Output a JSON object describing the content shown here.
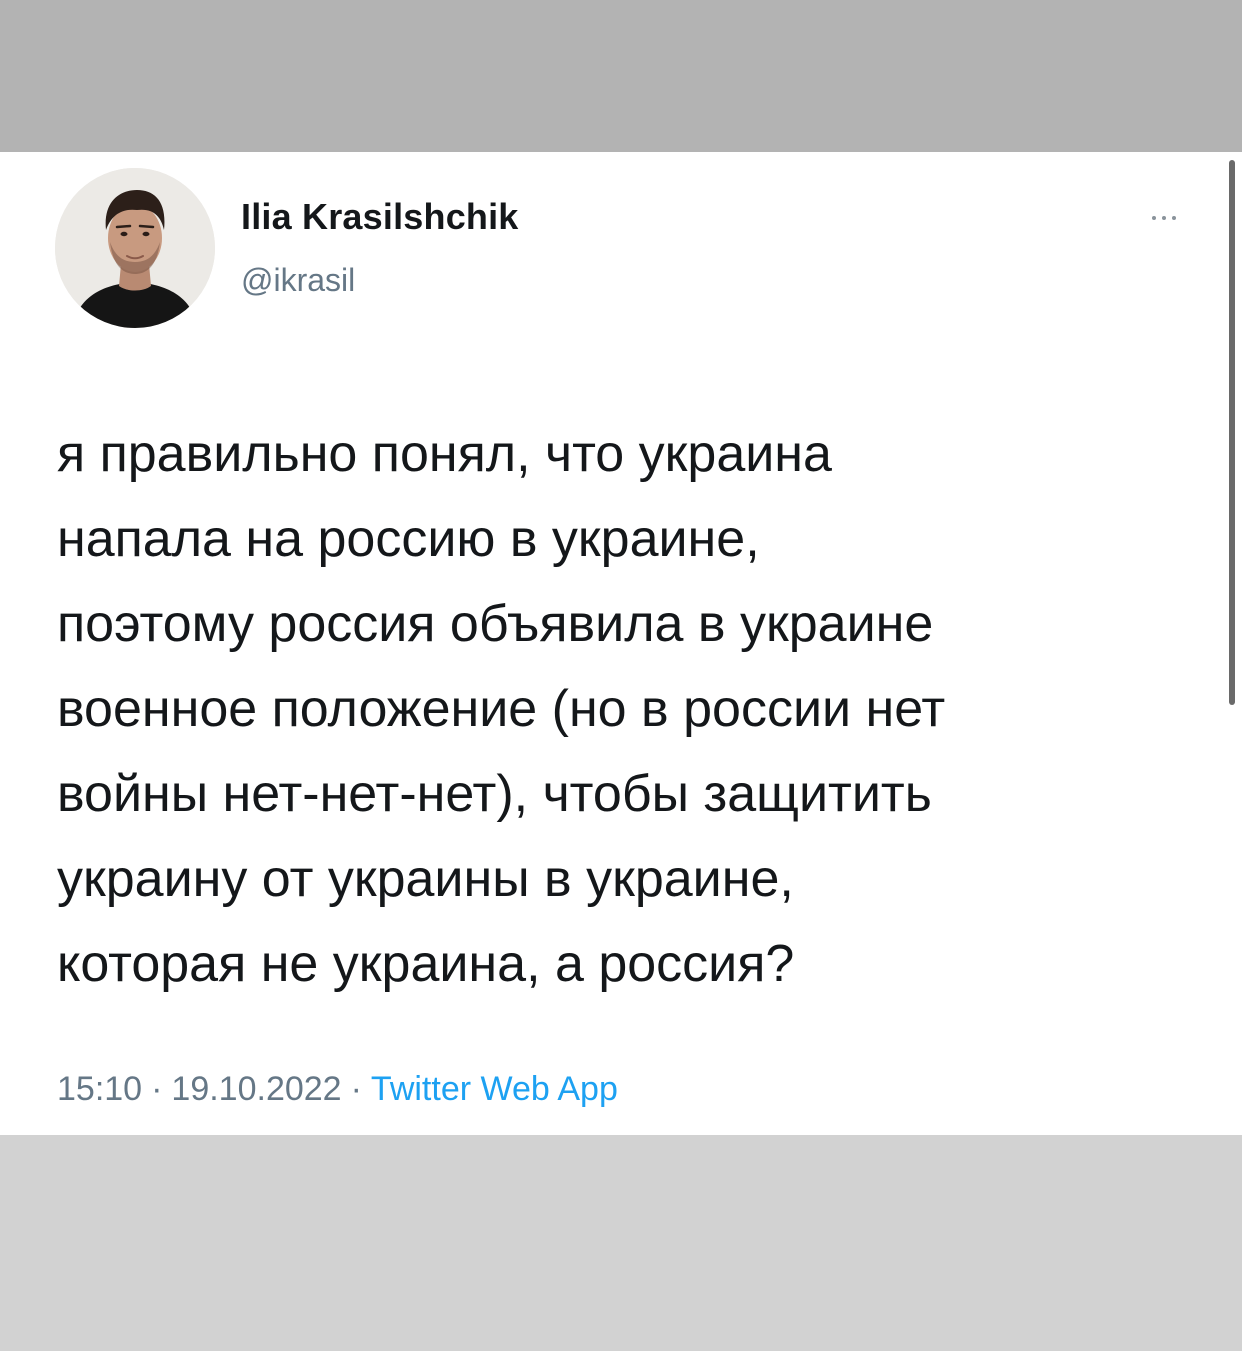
{
  "tweet": {
    "author": {
      "name": "Ilia Krasilshchik",
      "handle": "@ikrasil"
    },
    "more_icon": "more-horizontal-icon",
    "text": "я правильно понял, что украина\nнапала на россию в украине,\nпоэтому россия объявила в украине\nвоенное положение (но в россии нет\nвойны нет-нет-нет), чтобы защитить\nукраину от украины в украине,\nкоторая не украина, а россия?",
    "meta": {
      "time": "15:10",
      "separator": "·",
      "date": "19.10.2022",
      "source": "Twitter Web App"
    }
  },
  "colors": {
    "text_primary": "#14171a",
    "text_secondary": "#657786",
    "link": "#1da1f2",
    "background": "#ffffff",
    "surround_top": "#b3b3b3",
    "surround_bottom": "#d2d2d2"
  }
}
